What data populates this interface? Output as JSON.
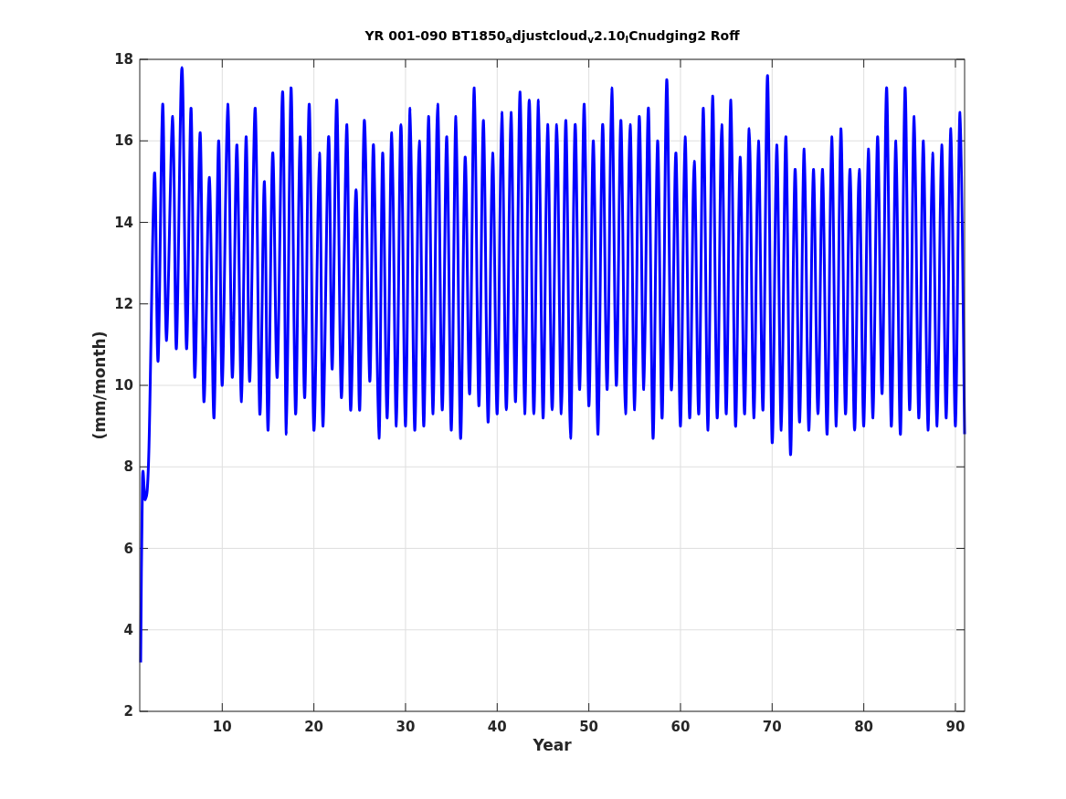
{
  "figure": {
    "chart_data": {
      "type": "line",
      "title": "YR 001-090 BT1850$_{a}$djustcloud$_{v}$2.10$_{l}$Cnudging2 Roff",
      "xlabel": "Year",
      "ylabel": "(mm/month)",
      "xlim": [
        1,
        91
      ],
      "ylim": [
        2,
        18
      ],
      "xticks": [
        10,
        20,
        30,
        40,
        50,
        60,
        70,
        80,
        90
      ],
      "yticks": [
        2,
        4,
        6,
        8,
        10,
        12,
        14,
        16,
        18
      ],
      "x": [
        1.1,
        1.3,
        1.6,
        2.0,
        2.6,
        3.0,
        3.5,
        3.9,
        4.6,
        5.0,
        5.6,
        6.1,
        6.6,
        7.0,
        7.6,
        8.0,
        8.6,
        9.1,
        9.6,
        10.0,
        10.6,
        11.1,
        11.6,
        12.1,
        12.6,
        13.0,
        13.6,
        14.1,
        14.6,
        15.0,
        15.5,
        16.0,
        16.6,
        17.0,
        17.5,
        18.0,
        18.5,
        19.0,
        19.5,
        20.0,
        20.6,
        21.0,
        21.6,
        22.0,
        22.5,
        23.0,
        23.6,
        24.0,
        24.6,
        25.0,
        25.5,
        26.1,
        26.5,
        27.1,
        27.5,
        28.0,
        28.5,
        29,
        29.5,
        30,
        30.5,
        31,
        31.5,
        32,
        32.5,
        33,
        33.5,
        34,
        34.5,
        35,
        35.5,
        36,
        36.5,
        37,
        37.5,
        38,
        38.5,
        39,
        39.5,
        40,
        40.5,
        41,
        41.5,
        42,
        42.5,
        43,
        43.5,
        44,
        44.5,
        45,
        45.5,
        46,
        46.5,
        47,
        47.5,
        48,
        48.5,
        49,
        49.5,
        50,
        50.5,
        51,
        51.5,
        52,
        52.5,
        53,
        53.5,
        54,
        54.5,
        55,
        55.5,
        56,
        56.5,
        57,
        57.5,
        58,
        58.5,
        59,
        59.5,
        60,
        60.5,
        61,
        61.5,
        62,
        62.5,
        63,
        63.5,
        64,
        64.5,
        65,
        65.5,
        66,
        66.5,
        67,
        67.5,
        68,
        68.5,
        69,
        69.5,
        70,
        70.5,
        71,
        71.5,
        72,
        72.5,
        73,
        73.5,
        74,
        74.5,
        75,
        75.5,
        76,
        76.5,
        77,
        77.5,
        78,
        78.5,
        79,
        79.5,
        80,
        80.5,
        81,
        81.5,
        82,
        82.5,
        83,
        83.5,
        84,
        84.5,
        85,
        85.5,
        86,
        86.5,
        87,
        87.5,
        88,
        88.5,
        89,
        89.5,
        90,
        90.5,
        91
      ],
      "grid": true,
      "series": [
        {
          "color": "#0000ff",
          "values": [
            3.2,
            7.7,
            7.2,
            8.4,
            15.2,
            10.6,
            16.9,
            11.1,
            16.6,
            10.9,
            17.8,
            10.9,
            16.8,
            10.2,
            16.2,
            9.6,
            15.1,
            9.2,
            16.0,
            10.0,
            16.9,
            10.2,
            15.9,
            9.6,
            16.1,
            10.1,
            16.8,
            9.3,
            15.0,
            8.9,
            15.7,
            10.2,
            17.2,
            8.8,
            17.3,
            9.3,
            16.1,
            9.7,
            16.9,
            8.9,
            15.7,
            9.0,
            16.1,
            10.4,
            17.0,
            9.7,
            16.4,
            9.4,
            14.8,
            9.4,
            16.5,
            10.1,
            15.9,
            8.7,
            15.7,
            9.2,
            16.2,
            9.0,
            16.4,
            9.0,
            16.8,
            8.9,
            16.0,
            9.0,
            16.6,
            9.3,
            16.9,
            9.4,
            16.1,
            8.9,
            16.6,
            8.7,
            15.6,
            9.8,
            17.3,
            9.5,
            16.5,
            9.1,
            15.7,
            9.3,
            16.7,
            9.4,
            16.7,
            9.6,
            17.2,
            9.3,
            17.0,
            9.3,
            17.0,
            9.2,
            16.4,
            9.4,
            16.4,
            9.3,
            16.5,
            8.7,
            16.4,
            9.9,
            16.9,
            9.5,
            16.0,
            8.8,
            16.4,
            9.9,
            17.3,
            10.0,
            16.5,
            9.3,
            16.4,
            9.4,
            16.6,
            9.9,
            16.8,
            8.7,
            16.0,
            9.2,
            17.5,
            9.9,
            15.7,
            9.0,
            16.1,
            9.2,
            15.5,
            9.3,
            16.8,
            8.9,
            17.1,
            9.2,
            16.4,
            9.3,
            17.0,
            9.0,
            15.6,
            9.3,
            16.3,
            9.2,
            16.0,
            9.4,
            17.6,
            8.6,
            15.9,
            8.9,
            16.1,
            8.3,
            15.3,
            9.1,
            15.8,
            8.9,
            15.3,
            9.3,
            15.3,
            8.8,
            16.1,
            9.0,
            16.3,
            9.3,
            15.3,
            8.9,
            15.3,
            9.0,
            15.8,
            9.2,
            16.1,
            9.8,
            17.3,
            9.0,
            16.0,
            8.8,
            17.3,
            9.4,
            16.6,
            9.2,
            16.0,
            8.9,
            15.7,
            9.0,
            15.9,
            9.2,
            16.3,
            9.0,
            16.7,
            8.8
          ]
        }
      ]
    }
  }
}
